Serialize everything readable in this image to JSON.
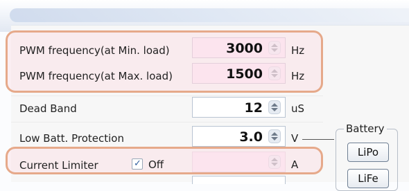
{
  "rows": {
    "pwm_min": {
      "label": "PWM frequency(at Min. load)",
      "value": "3000",
      "unit": "Hz"
    },
    "pwm_max": {
      "label": "PWM frequency(at Max. load)",
      "value": "1500",
      "unit": "Hz"
    },
    "dead_band": {
      "label": "Dead Band",
      "value": "12",
      "unit": "uS"
    },
    "low_batt": {
      "label": "Low Batt. Protection",
      "value": "3.0",
      "unit": "V"
    },
    "current_limiter": {
      "label": "Current Limiter",
      "checkbox_label": "Off",
      "checked": true,
      "value": "",
      "unit": "A"
    }
  },
  "battery": {
    "legend": "Battery",
    "buttons": [
      "LiPo",
      "LiFe"
    ]
  },
  "colors": {
    "highlight_border": "#e6a98a",
    "highlight_fill": "#fce4ee",
    "spin_border": "#b9c4d2"
  }
}
